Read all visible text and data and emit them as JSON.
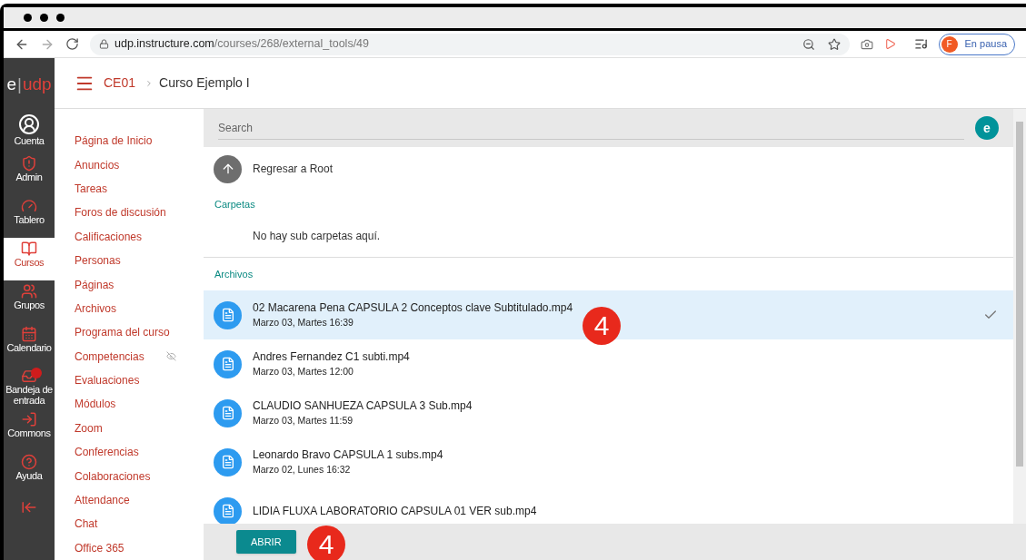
{
  "browser": {
    "url_host": "udp.instructure.com",
    "url_path": "/courses/268/external_tools/49",
    "profile_initial": "F",
    "profile_status": "En pausa"
  },
  "logo": {
    "left": "e",
    "separator": "|",
    "right": "udp"
  },
  "global_nav": [
    {
      "kind": "avatar",
      "label": "Cuenta",
      "selected": false
    },
    {
      "kind": "shield",
      "label": "Admin",
      "selected": false
    },
    {
      "kind": "gauge",
      "label": "Tablero",
      "selected": false
    },
    {
      "kind": "book",
      "label": "Cursos",
      "selected": true
    },
    {
      "kind": "users",
      "label": "Grupos",
      "selected": false
    },
    {
      "kind": "calendar",
      "label": "Calendario",
      "selected": false
    },
    {
      "kind": "inbox",
      "label": "Bandeja de entrada",
      "selected": false
    },
    {
      "kind": "commons",
      "label": "Commons",
      "selected": false
    },
    {
      "kind": "help",
      "label": "Ayuda",
      "selected": false
    }
  ],
  "breadcrumb": [
    "CE01",
    "Curso Ejemplo I"
  ],
  "course_nav": [
    {
      "label": "Página de Inicio",
      "hidden": false
    },
    {
      "label": "Anuncios",
      "hidden": false
    },
    {
      "label": "Tareas",
      "hidden": false
    },
    {
      "label": "Foros de discusión",
      "hidden": false
    },
    {
      "label": "Calificaciones",
      "hidden": false
    },
    {
      "label": "Personas",
      "hidden": false
    },
    {
      "label": "Páginas",
      "hidden": false
    },
    {
      "label": "Archivos",
      "hidden": false
    },
    {
      "label": "Programa del curso",
      "hidden": false
    },
    {
      "label": "Competencias",
      "hidden": true
    },
    {
      "label": "Evaluaciones",
      "hidden": false
    },
    {
      "label": "Módulos",
      "hidden": false
    },
    {
      "label": "Zoom",
      "hidden": false
    },
    {
      "label": "Conferencias",
      "hidden": false
    },
    {
      "label": "Colaboraciones",
      "hidden": false
    },
    {
      "label": "Attendance",
      "hidden": false
    },
    {
      "label": "Chat",
      "hidden": false
    },
    {
      "label": "Office 365",
      "hidden": false
    }
  ],
  "search": {
    "placeholder": "Search",
    "avatar": "e"
  },
  "back_label": "Regresar a Root",
  "folders_heading": "Carpetas",
  "folders_empty": "No hay sub carpetas aquí.",
  "files_heading": "Archivos",
  "files": [
    {
      "name": "02 Macarena Pena CAPSULA 2 Conceptos clave Subtitulado.mp4",
      "date": "Marzo 03, Martes 16:39",
      "selected": true
    },
    {
      "name": "Andres Fernandez C1 subti.mp4",
      "date": "Marzo 03, Martes 12:00",
      "selected": false
    },
    {
      "name": "CLAUDIO SANHUEZA CAPSULA 3 Sub.mp4",
      "date": "Marzo 03, Martes 11:59",
      "selected": false
    },
    {
      "name": "Leonardo Bravo CAPSULA 1 subs.mp4",
      "date": "Marzo 02, Lunes 16:32",
      "selected": false
    },
    {
      "name": "LIDIA FLUXA LABORATORIO CAPSULA 01 VER sub.mp4",
      "selected": false
    }
  ],
  "open_button": "ABRIR",
  "step_markers": [
    "4",
    "4"
  ]
}
